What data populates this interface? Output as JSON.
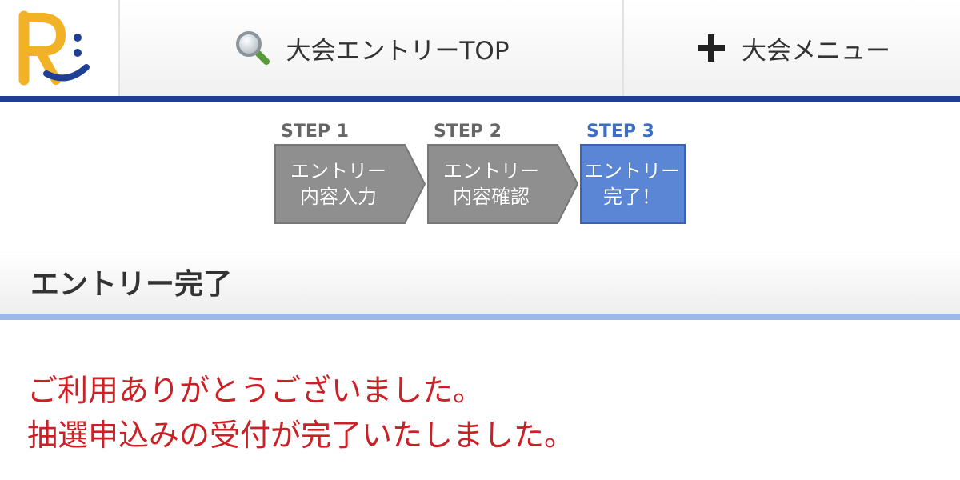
{
  "header": {
    "logo_letter": "R",
    "nav_top_label": "大会エントリーTOP",
    "nav_menu_label": "大会メニュー",
    "nav_top_icon": "magnifier-icon",
    "nav_menu_icon": "plus-icon"
  },
  "steps": [
    {
      "label": "STEP 1",
      "line1": "エントリー",
      "line2": "内容入力",
      "state": "done"
    },
    {
      "label": "STEP 2",
      "line1": "エントリー",
      "line2": "内容確認",
      "state": "done"
    },
    {
      "label": "STEP 3",
      "line1": "エントリー",
      "line2": "完了！",
      "state": "current"
    }
  ],
  "section": {
    "title": "エントリー完了"
  },
  "message": {
    "line1": "ご利用ありがとうございました。",
    "line2": "抽選申込みの受付が完了いたしました。"
  },
  "colors": {
    "header_line": "#1e3f94",
    "step_done": "#8f8f8f",
    "step_current": "#5b86d6",
    "step_current_label": "#3d6ec4",
    "section_line": "#9db8e6",
    "message_text": "#cc2027"
  }
}
